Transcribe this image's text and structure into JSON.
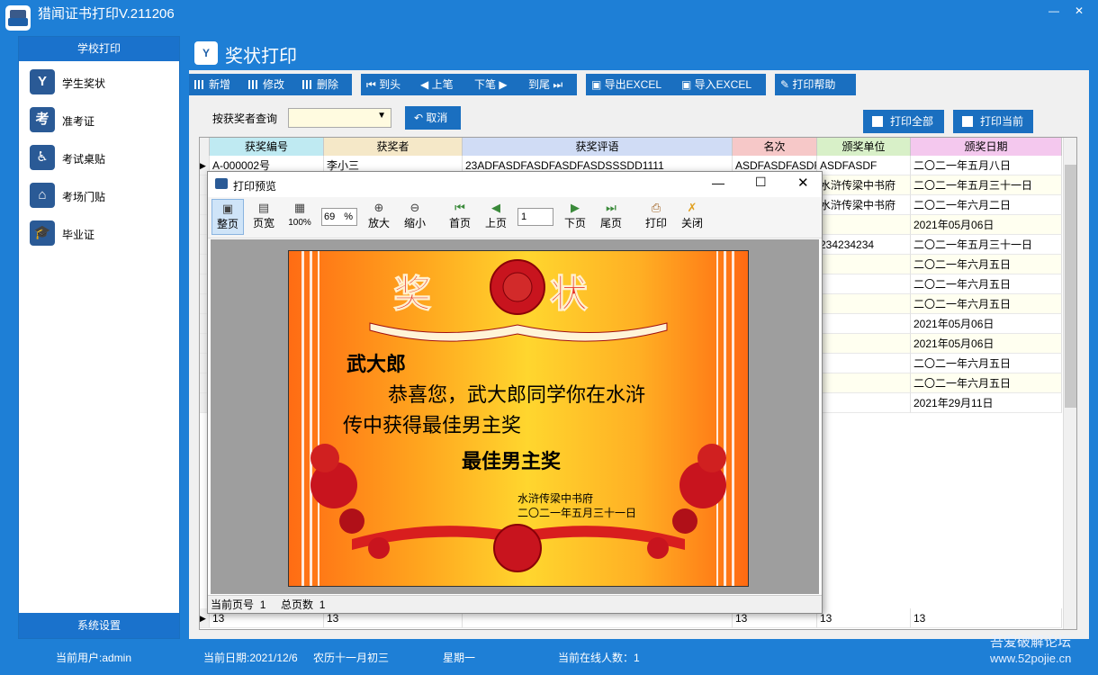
{
  "app": {
    "title": "猎闻证书打印V.211206"
  },
  "sidebar": {
    "header": "学校打印",
    "items": [
      {
        "label": "学生奖状",
        "icon": "medal-icon",
        "glyph": "Y"
      },
      {
        "label": "准考证",
        "icon": "exam-card-icon",
        "glyph": "考"
      },
      {
        "label": "考试桌贴",
        "icon": "desk-icon",
        "glyph": "♿"
      },
      {
        "label": "考场门贴",
        "icon": "house-icon",
        "glyph": "⌂"
      },
      {
        "label": "毕业证",
        "icon": "graduation-cap-icon",
        "glyph": "🎓"
      }
    ],
    "footer": "系统设置"
  },
  "main": {
    "title": "奖状打印",
    "toolbar": {
      "add": "新增",
      "edit": "修改",
      "delete": "删除",
      "first": "到头",
      "prev": "上笔",
      "next": "下笔",
      "last": "到尾",
      "export": "导出EXCEL",
      "import": "导入EXCEL",
      "help": "打印帮助"
    },
    "search": {
      "label": "按获奖者查询",
      "value": "",
      "cancel": "取消",
      "print_all": "打印全部",
      "print_current": "打印当前"
    },
    "table": {
      "columns": [
        "获奖编号",
        "获奖者",
        "获奖评语",
        "名次",
        "颁奖单位",
        "颁奖日期"
      ],
      "column_colors": [
        "#bfeaf2",
        "#f5e8c8",
        "#d0dcf5",
        "#f6c8c8",
        "#d8f0c8",
        "#f4c8ee"
      ],
      "rows": [
        [
          "A-000002号",
          "李小三",
          "23ADFASDFASDFASDFASDSSSDD1111",
          "ASDFASDFASDF",
          "ASDFASDF",
          "二〇二一年五月八日"
        ],
        [
          "",
          "",
          "",
          "",
          "水浒传梁中书府",
          "二〇二一年五月三十一日"
        ],
        [
          "",
          "",
          "",
          "",
          "水浒传梁中书府",
          "二〇二一年六月二日"
        ],
        [
          "",
          "",
          "",
          "",
          "",
          "2021年05月06日"
        ],
        [
          "",
          "",
          "",
          "",
          "234234234",
          "二〇二一年五月三十一日"
        ],
        [
          "",
          "",
          "",
          "",
          "",
          "二〇二一年六月五日"
        ],
        [
          "",
          "",
          "",
          "",
          "",
          "二〇二一年六月五日"
        ],
        [
          "",
          "",
          "",
          "",
          "",
          "二〇二一年六月五日"
        ],
        [
          "",
          "",
          "",
          "",
          "",
          "2021年05月06日"
        ],
        [
          "",
          "",
          "",
          "",
          "",
          "2021年05月06日"
        ],
        [
          "",
          "",
          "",
          "",
          "",
          "二〇二一年六月五日"
        ],
        [
          "",
          "",
          "",
          "",
          "",
          "二〇二一年六月五日"
        ],
        [
          "",
          "",
          "",
          "",
          "",
          "2021年29月11日"
        ]
      ],
      "last_row": [
        "13",
        "13",
        "",
        "13",
        "13",
        "13"
      ]
    }
  },
  "preview": {
    "title": "打印预览",
    "tools": {
      "whole": "整页",
      "width": "页宽",
      "hundred": "100%",
      "zoom": "69",
      "percent": "%",
      "zoom_in": "放大",
      "zoom_out": "缩小",
      "first": "首页",
      "prev": "上页",
      "page": "1",
      "next": "下页",
      "last": "尾页",
      "print": "打印",
      "close": "关闭"
    },
    "status": {
      "page_label": "当前页号",
      "page": "1",
      "total_label": "总页数",
      "total": "1"
    },
    "certificate": {
      "heading": "奖 状",
      "name": "武大郎",
      "body_line1": "恭喜您，武大郎同学你在水浒",
      "body_line2": "传中获得最佳男主奖",
      "award": "最佳男主奖",
      "issuer": "水浒传梁中书府",
      "date": "二〇二一年五月三十一日"
    }
  },
  "status": {
    "user": "当前用户:admin",
    "date": "当前日期:2021/12/6",
    "lunar": "农历十一月初三",
    "weekday": "星期一",
    "online": "当前在线人数：1",
    "watermark": "吾爱破解论坛",
    "watermark_url": "www.52pojie.cn"
  }
}
